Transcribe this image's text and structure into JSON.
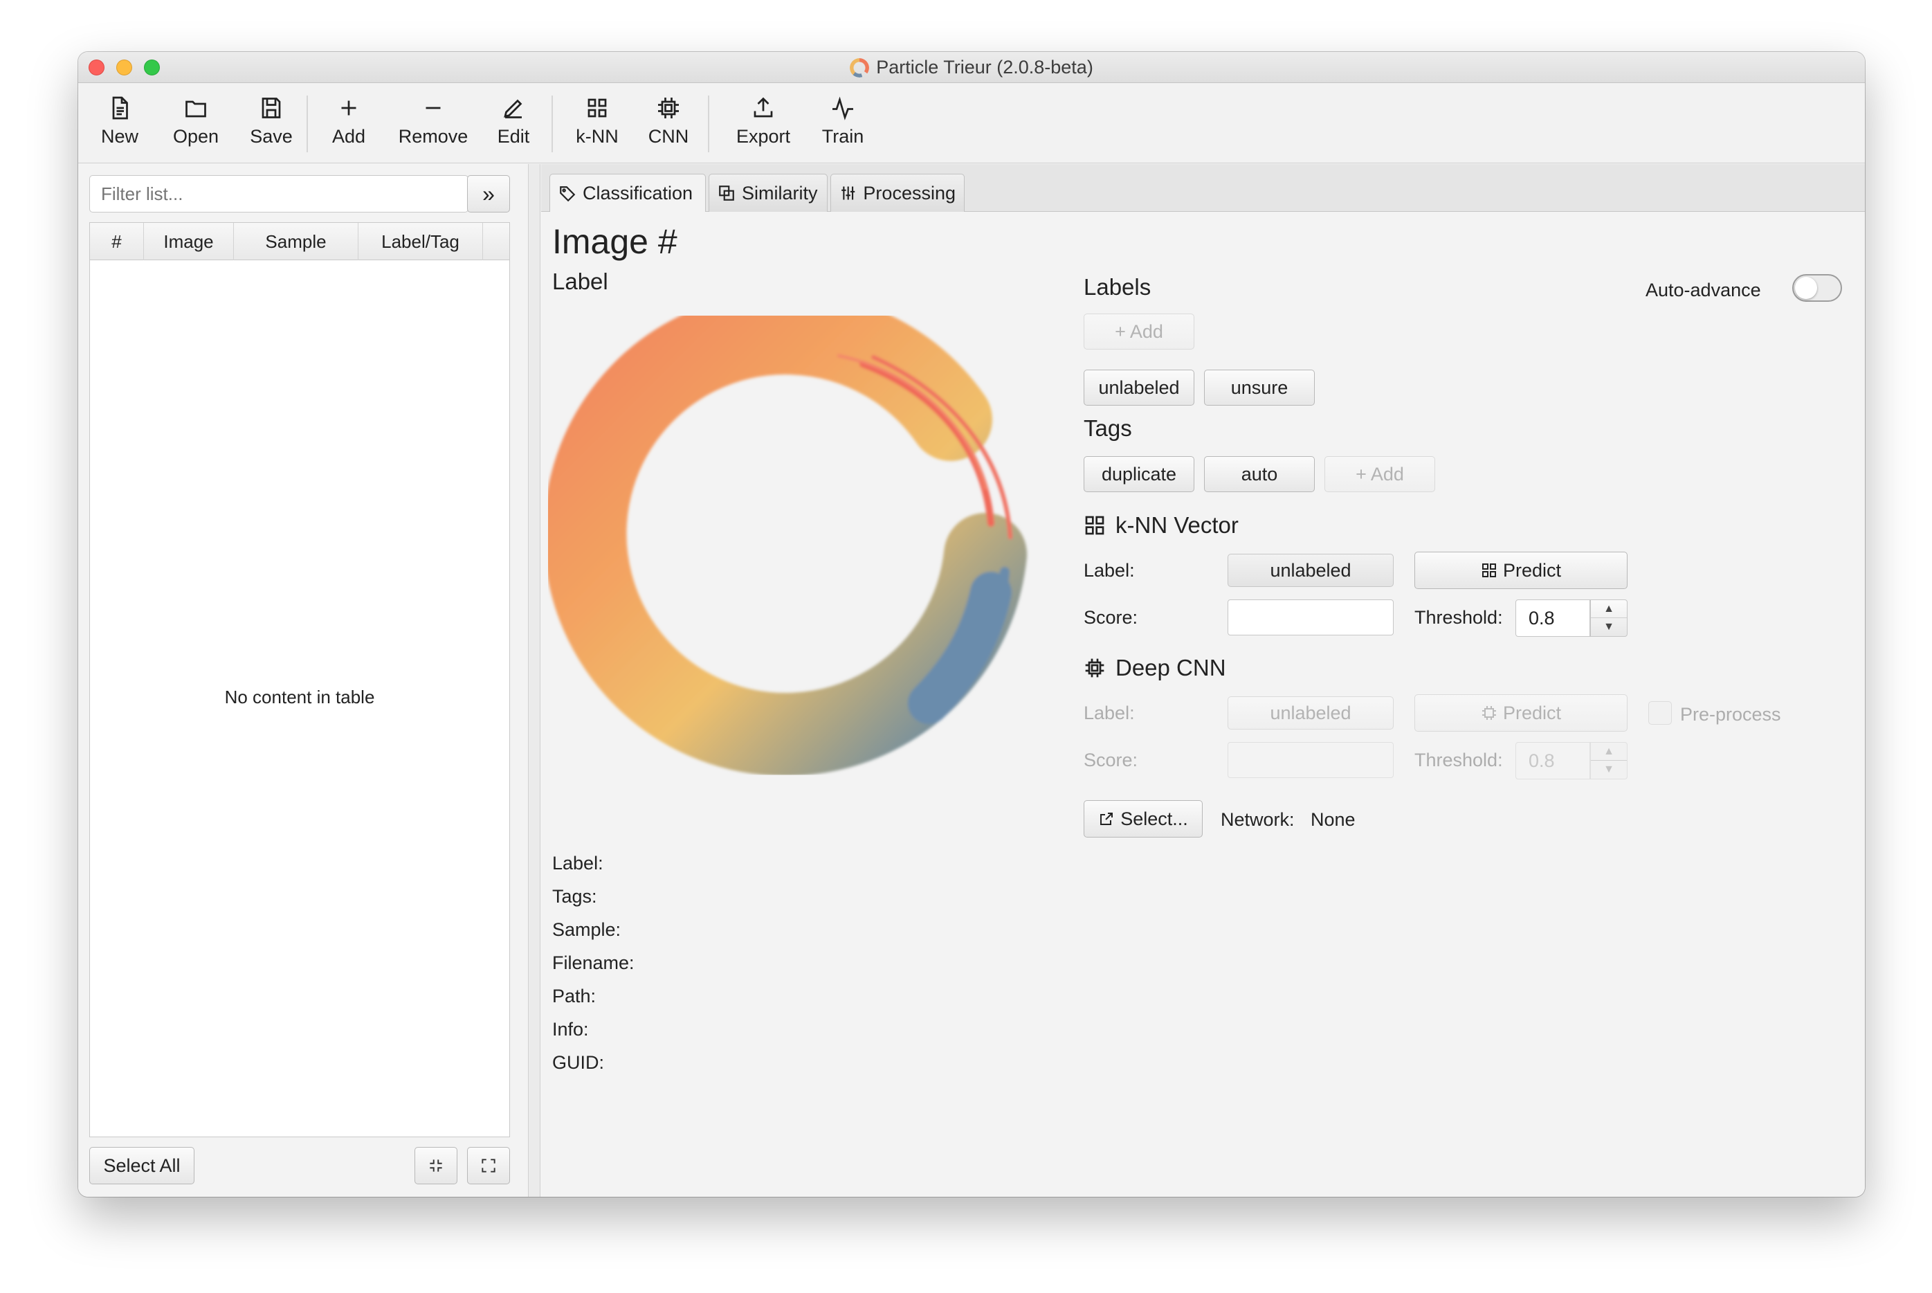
{
  "window": {
    "title": "Particle Trieur (2.0.8-beta)"
  },
  "toolbar": {
    "new": "New",
    "open": "Open",
    "save": "Save",
    "add": "Add",
    "remove": "Remove",
    "edit": "Edit",
    "knn": "k-NN",
    "cnn": "CNN",
    "export": "Export",
    "train": "Train"
  },
  "left": {
    "filter_placeholder": "Filter list...",
    "expand_button": "»",
    "columns": [
      "#",
      "Image",
      "Sample",
      "Label/Tag"
    ],
    "empty_message": "No content in table",
    "select_all": "Select All"
  },
  "tabs": [
    {
      "label": "Classification",
      "icon": "tag-icon",
      "active": true
    },
    {
      "label": "Similarity",
      "icon": "copy-icon",
      "active": false
    },
    {
      "label": "Processing",
      "icon": "sliders-icon",
      "active": false
    }
  ],
  "image_panel": {
    "title": "Image #",
    "label_heading": "Label",
    "image": "enso-circle-placeholder",
    "info_fields": [
      "Label:",
      "Tags:",
      "Sample:",
      "Filename:",
      "Path:",
      "Info:",
      "GUID:"
    ]
  },
  "labels": {
    "heading": "Labels",
    "auto_advance": "Auto-advance",
    "auto_advance_on": false,
    "add": "+ Add",
    "items": [
      "unlabeled",
      "unsure"
    ]
  },
  "tags": {
    "heading": "Tags",
    "items": [
      "duplicate",
      "auto"
    ],
    "add": "+ Add"
  },
  "knn": {
    "heading": "k-NN Vector",
    "label_caption": "Label:",
    "label_value": "unlabeled",
    "predict": "Predict",
    "score_caption": "Score:",
    "score_value": "",
    "threshold_caption": "Threshold:",
    "threshold_value": "0.8"
  },
  "cnn": {
    "heading": "Deep CNN",
    "label_caption": "Label:",
    "label_value": "unlabeled",
    "predict": "Predict",
    "preprocess": "Pre-process",
    "score_caption": "Score:",
    "score_value": "",
    "threshold_caption": "Threshold:",
    "threshold_value": "0.8",
    "select": "Select...",
    "network_caption": "Network:",
    "network_value": "None"
  }
}
